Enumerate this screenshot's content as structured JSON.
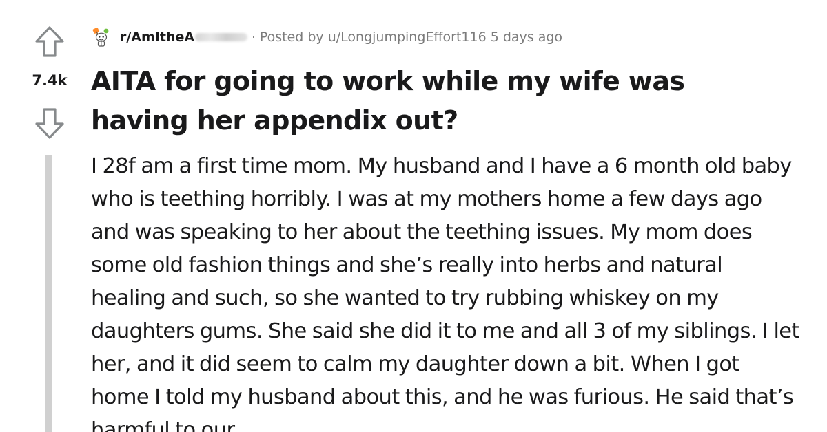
{
  "vote": {
    "score": "7.4k"
  },
  "post": {
    "subreddit": "r/AmItheA",
    "separator": "·",
    "posted_by_prefix": "Posted by ",
    "author": "u/LongjumpingEffort116",
    "age": " 5 days ago",
    "title": "AITA for going to work while my wife was having her appendix out?",
    "body": "I 28f am a first time mom. My husband and I have a 6 month old baby who is teething horribly. I was at my mothers home a few days ago and was speaking to her about the teething issues. My mom does some old fashion things and she’s really into herbs and natural healing and such, so she wanted to try rubbing whiskey on my daughters gums. She said she did it to me and all 3 of my siblings. I let her, and it did seem to calm my daughter down a bit. When I got home I told my husband about this, and he was furious. He said that’s harmful to our"
  },
  "icons": {
    "upvote": "arrow-up-outline-icon",
    "downvote": "arrow-down-outline-icon",
    "subreddit": "snoo-judge-icon"
  },
  "colors": {
    "text": "#1a1a1b",
    "meta": "#7c7c7c",
    "thread_line": "#d0d0d0",
    "icon_stroke": "#878a8c"
  }
}
